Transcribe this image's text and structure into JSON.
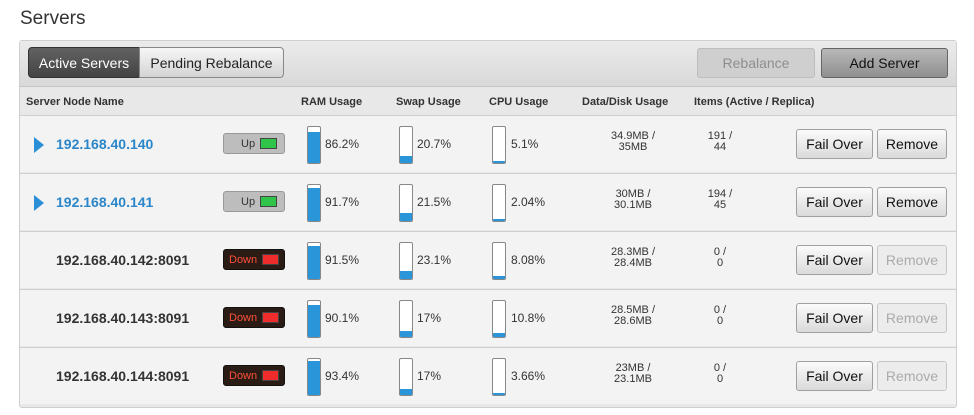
{
  "page": {
    "title": "Servers"
  },
  "tabs": [
    {
      "label": "Active Servers",
      "active": true
    },
    {
      "label": "Pending Rebalance",
      "active": false
    }
  ],
  "toolbar": {
    "rebalance_label": "Rebalance",
    "add_server_label": "Add Server"
  },
  "columns": {
    "node_name": "Server Node Name",
    "ram": "RAM Usage",
    "swap": "Swap Usage",
    "cpu": "CPU Usage",
    "disk": "Data/Disk Usage",
    "items": "Items (Active / Replica)"
  },
  "colors": {
    "accent_blue": "#2a95d9",
    "link_blue": "#2a86c9",
    "status_up": "#31c44a",
    "status_down": "#ee2c2c"
  },
  "servers": [
    {
      "name": "192.168.40.140",
      "expandable": true,
      "status": "Up",
      "ram": "86.2%",
      "ram_level": 0.862,
      "swap": "20.7%",
      "swap_level": 0.207,
      "cpu": "5.1%",
      "cpu_level": 0.051,
      "disk_top": "34.9MB /",
      "disk_bottom": "35MB",
      "items_top": "191 /",
      "items_bottom": "44",
      "failover_label": "Fail Over",
      "remove_label": "Remove",
      "remove_enabled": true
    },
    {
      "name": "192.168.40.141",
      "expandable": true,
      "status": "Up",
      "ram": "91.7%",
      "ram_level": 0.917,
      "swap": "21.5%",
      "swap_level": 0.215,
      "cpu": "2.04%",
      "cpu_level": 0.0204,
      "disk_top": "30MB /",
      "disk_bottom": "30.1MB",
      "items_top": "194 /",
      "items_bottom": "45",
      "failover_label": "Fail Over",
      "remove_label": "Remove",
      "remove_enabled": true
    },
    {
      "name": "192.168.40.142:8091",
      "expandable": false,
      "status": "Down",
      "ram": "91.5%",
      "ram_level": 0.915,
      "swap": "23.1%",
      "swap_level": 0.231,
      "cpu": "8.08%",
      "cpu_level": 0.0808,
      "disk_top": "28.3MB /",
      "disk_bottom": "28.4MB",
      "items_top": "0 /",
      "items_bottom": "0",
      "failover_label": "Fail Over",
      "remove_label": "Remove",
      "remove_enabled": false
    },
    {
      "name": "192.168.40.143:8091",
      "expandable": false,
      "status": "Down",
      "ram": "90.1%",
      "ram_level": 0.901,
      "swap": "17%",
      "swap_level": 0.17,
      "cpu": "10.8%",
      "cpu_level": 0.108,
      "disk_top": "28.5MB /",
      "disk_bottom": "28.6MB",
      "items_top": "0 /",
      "items_bottom": "0",
      "failover_label": "Fail Over",
      "remove_label": "Remove",
      "remove_enabled": false
    },
    {
      "name": "192.168.40.144:8091",
      "expandable": false,
      "status": "Down",
      "ram": "93.4%",
      "ram_level": 0.934,
      "swap": "17%",
      "swap_level": 0.17,
      "cpu": "3.66%",
      "cpu_level": 0.0366,
      "disk_top": "23MB /",
      "disk_bottom": "23.1MB",
      "items_top": "0 /",
      "items_bottom": "0",
      "failover_label": "Fail Over",
      "remove_label": "Remove",
      "remove_enabled": false
    }
  ]
}
